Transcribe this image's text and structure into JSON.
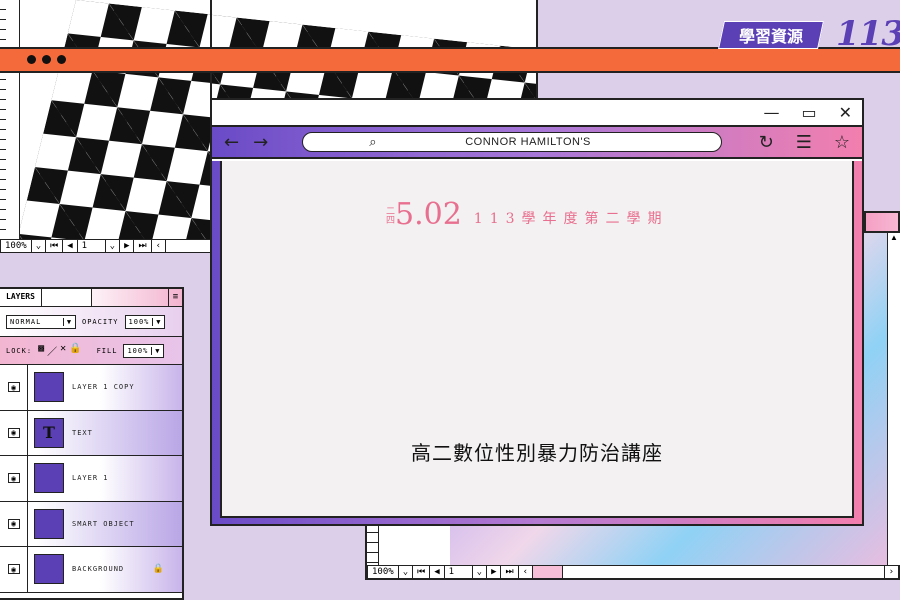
{
  "badge": {
    "label": "學習資源",
    "number": "113"
  },
  "checker_window": {
    "nav": {
      "zoom": "100%",
      "page": "1"
    }
  },
  "layers_panel": {
    "tab": "LAYERS",
    "blend_mode": "NORMAL",
    "opacity_label": "OPACITY",
    "opacity_value": "100%",
    "lock_label": "LOCK:",
    "fill_label": "FILL",
    "fill_value": "100%",
    "layers": [
      {
        "name": "LAYER 1 COPY",
        "thumb": ""
      },
      {
        "name": "TEXT",
        "thumb": "T"
      },
      {
        "name": "LAYER 1",
        "thumb": ""
      },
      {
        "name": "SMART OBJECT",
        "thumb": ""
      },
      {
        "name": "BACKGROUND",
        "thumb": "",
        "locked": true
      }
    ]
  },
  "browser": {
    "url": "CONNOR HAMILTON'S",
    "date_weekday": "二四",
    "date_big": "5.02",
    "date_rest": "113學年度第二學期",
    "event_title": "高二數位性別暴力防治講座"
  },
  "back_window": {
    "nav": {
      "zoom": "100%",
      "page": "1"
    }
  },
  "colors": {
    "background": "#dccfea",
    "accent_purple": "#5b3fb5",
    "accent_orange": "#f56a3a",
    "accent_pink": "#e86f8f"
  }
}
